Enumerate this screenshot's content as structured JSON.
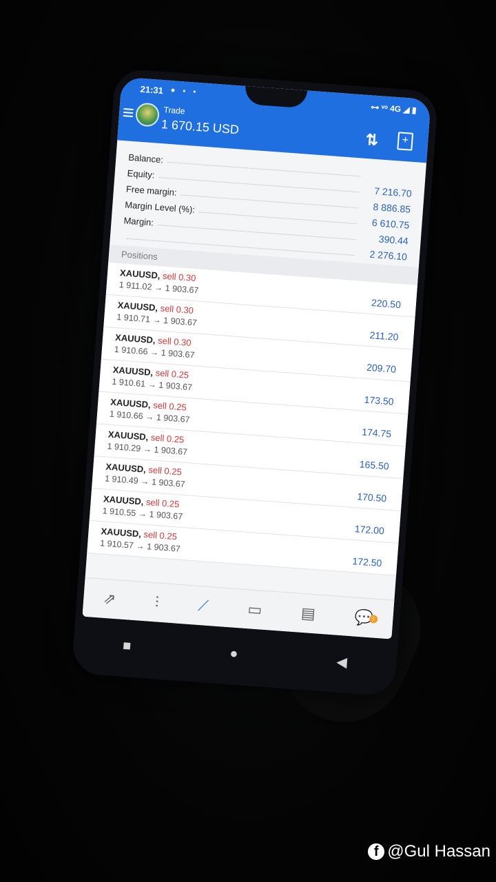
{
  "status": {
    "time": "21:31",
    "left_icons": "● ▪ ▪",
    "right_icons": "⊶ ᵛᵒ 4G ◢ ▮"
  },
  "header": {
    "title": "Trade",
    "balance": "1 670.15 USD",
    "sort_icon": "sort-icon",
    "new_order_icon": "new-order-icon"
  },
  "summary": [
    {
      "label": "Balance:",
      "value": ""
    },
    {
      "label": "Equity:",
      "value": "7 216.70"
    },
    {
      "label": "Free margin:",
      "value": "8 886.85"
    },
    {
      "label": "Margin Level (%):",
      "value": "6 610.75"
    },
    {
      "label": "Margin:",
      "value": "390.44"
    },
    {
      "label": "",
      "value": "2 276.10"
    }
  ],
  "positions_header": "Positions",
  "positions": [
    {
      "symbol": "XAUUSD,",
      "type": "sell 0.30",
      "prices": "1 911.02 → 1 903.67",
      "profit": "220.50"
    },
    {
      "symbol": "XAUUSD,",
      "type": "sell 0.30",
      "prices": "1 910.71 → 1 903.67",
      "profit": "211.20"
    },
    {
      "symbol": "XAUUSD,",
      "type": "sell 0.30",
      "prices": "1 910.66 → 1 903.67",
      "profit": "209.70"
    },
    {
      "symbol": "XAUUSD,",
      "type": "sell 0.25",
      "prices": "1 910.61 → 1 903.67",
      "profit": "173.50"
    },
    {
      "symbol": "XAUUSD,",
      "type": "sell 0.25",
      "prices": "1 910.66 → 1 903.67",
      "profit": "174.75"
    },
    {
      "symbol": "XAUUSD,",
      "type": "sell 0.25",
      "prices": "1 910.29 → 1 903.67",
      "profit": "165.50"
    },
    {
      "symbol": "XAUUSD,",
      "type": "sell 0.25",
      "prices": "1 910.49 → 1 903.67",
      "profit": "170.50"
    },
    {
      "symbol": "XAUUSD,",
      "type": "sell 0.25",
      "prices": "1 910.55 → 1 903.67",
      "profit": "172.00"
    },
    {
      "symbol": "XAUUSD,",
      "type": "sell 0.25",
      "prices": "1 910.57 → 1 903.67",
      "profit": "172.50"
    }
  ],
  "bottom_nav": [
    {
      "icon": "quotes-icon",
      "glyph": "⇗",
      "active": false
    },
    {
      "icon": "chart-icon",
      "glyph": "⫶",
      "active": false
    },
    {
      "icon": "trade-icon",
      "glyph": "⟋",
      "active": true
    },
    {
      "icon": "history-icon",
      "glyph": "▭",
      "active": false
    },
    {
      "icon": "news-icon",
      "glyph": "▤",
      "active": false
    },
    {
      "icon": "chat-icon",
      "glyph": "💬",
      "active": false
    }
  ],
  "chat_badge": "!",
  "system_nav": {
    "recents": "■",
    "home": "●",
    "back": "◀"
  },
  "watermark": {
    "icon": "facebook-icon",
    "glyph": "f",
    "text": "@Gul Hassan"
  },
  "colors": {
    "appbar": "#1f6fe0",
    "profit": "#2b61b9",
    "sell": "#d43a3a"
  }
}
